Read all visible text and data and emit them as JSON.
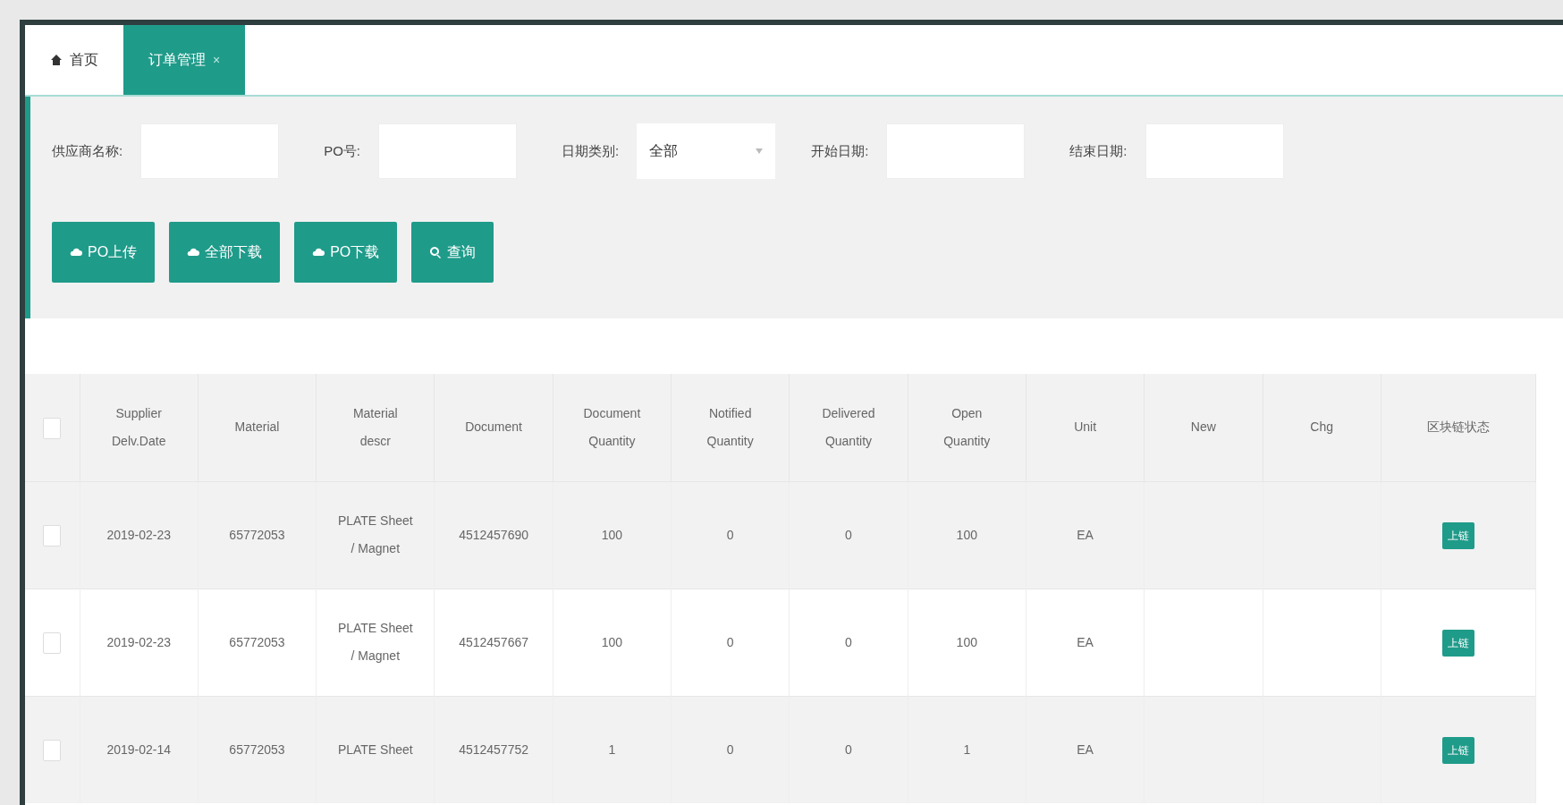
{
  "tabs": [
    {
      "label": "首页",
      "kind": "home",
      "selected": false,
      "closable": false
    },
    {
      "label": "订单管理",
      "kind": "page",
      "selected": true,
      "closable": true,
      "close": "×"
    }
  ],
  "filters": [
    {
      "label": "供应商名称:",
      "kind": "text"
    },
    {
      "label": "PO号:",
      "kind": "text"
    },
    {
      "label": "日期类别:",
      "kind": "select",
      "value": "全部"
    },
    {
      "label": "开始日期:",
      "kind": "text"
    },
    {
      "label": "结束日期:",
      "kind": "text"
    }
  ],
  "buttons": [
    {
      "label": "PO上传",
      "kind": "upload"
    },
    {
      "label": "全部下载",
      "kind": "download"
    },
    {
      "label": "PO下载",
      "kind": "download"
    },
    {
      "label": "查询",
      "kind": "search"
    }
  ],
  "table": {
    "header_checked": false,
    "columns": [
      "Supplier Delv.Date",
      "Material",
      "Material descr",
      "Document",
      "Document Quantity",
      "Notified Quantity",
      "Delivered Quantity",
      "Open Quantity",
      "Unit",
      "New",
      "Chg",
      "区块链状态"
    ],
    "rows": [
      {
        "checked": false,
        "cells": [
          "2019-02-23",
          "65772053",
          "PLATE Sheet / Magnet",
          "4512457690",
          "100",
          "0",
          "0",
          "100",
          "EA",
          "",
          ""
        ],
        "status": "上链"
      },
      {
        "checked": false,
        "cells": [
          "2019-02-23",
          "65772053",
          "PLATE Sheet / Magnet",
          "4512457667",
          "100",
          "0",
          "0",
          "100",
          "EA",
          "",
          ""
        ],
        "status": "上链"
      },
      {
        "checked": false,
        "cells": [
          "2019-02-14",
          "65772053",
          "PLATE Sheet",
          "4512457752",
          "1",
          "0",
          "0",
          "1",
          "EA",
          "",
          ""
        ],
        "status": "上链"
      }
    ]
  }
}
